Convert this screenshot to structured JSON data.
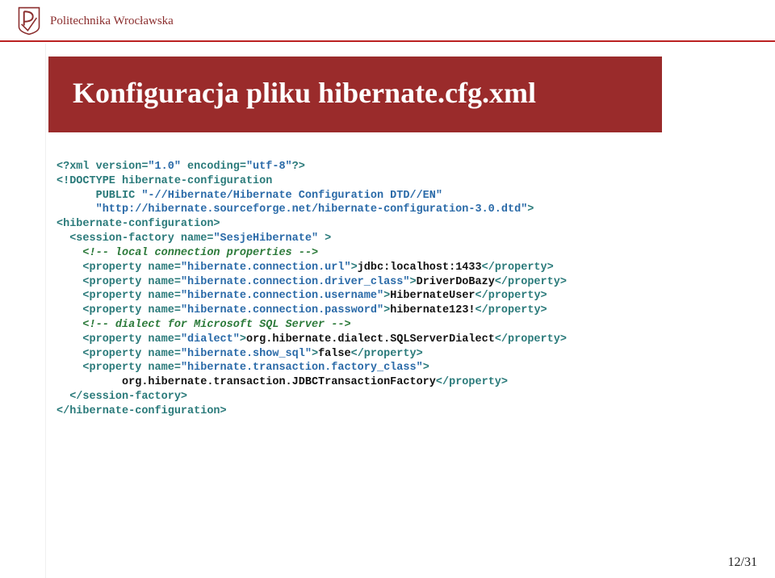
{
  "header": {
    "university": "Politechnika Wrocławska"
  },
  "title": "Konfiguracja pliku hibernate.cfg.xml",
  "code": {
    "l1a": "<?xml version=",
    "l1q1": "\"1.0\"",
    "l1b": " encoding=",
    "l1q2": "\"utf-8\"",
    "l1c": "?>",
    "l2": "<!DOCTYPE hibernate-configuration",
    "l3a": "      PUBLIC ",
    "l3q": "\"-//Hibernate/Hibernate Configuration DTD//EN\"",
    "l4q": "      \"http://hibernate.sourceforge.net/hibernate-configuration-3.0.dtd\"",
    "l4b": ">",
    "l5": "<hibernate-configuration>",
    "l6a": "  <session-factory name=",
    "l6q": "\"SesjeHibernate\"",
    "l6b": " >",
    "l7": "    <!-- local connection properties -->",
    "l8a": "    <property name=",
    "l8q": "\"hibernate.connection.url\"",
    "l8b": ">",
    "l8t": "jdbc:localhost:1433",
    "l8c": "</property>",
    "l9a": "    <property name=",
    "l9q": "\"hibernate.connection.driver_class\"",
    "l9b": ">",
    "l9t": "DriverDoBazy",
    "l9c": "</property>",
    "l10a": "    <property name=",
    "l10q": "\"hibernate.connection.username\"",
    "l10b": ">",
    "l10t": "HibernateUser",
    "l10c": "</property>",
    "l11a": "    <property name=",
    "l11q": "\"hibernate.connection.password\"",
    "l11b": ">",
    "l11t": "hibernate123!",
    "l11c": "</property>",
    "l12": "    <!-- dialect for Microsoft SQL Server -->",
    "l13a": "    <property name=",
    "l13q": "\"dialect\"",
    "l13b": ">",
    "l13t": "org.hibernate.dialect.SQLServerDialect",
    "l13c": "</property>",
    "l14a": "    <property name=",
    "l14q": "\"hibernate.show_sql\"",
    "l14b": ">",
    "l14t": "false",
    "l14c": "</property>",
    "l15a": "    <property name=",
    "l15q": "\"hibernate.transaction.factory_class\"",
    "l15b": ">",
    "l16t": "          org.hibernate.transaction.JDBCTransactionFactory",
    "l16c": "</property>",
    "l17": "  </session-factory>",
    "l18": "</hibernate-configuration>"
  },
  "pageNum": "12/31"
}
